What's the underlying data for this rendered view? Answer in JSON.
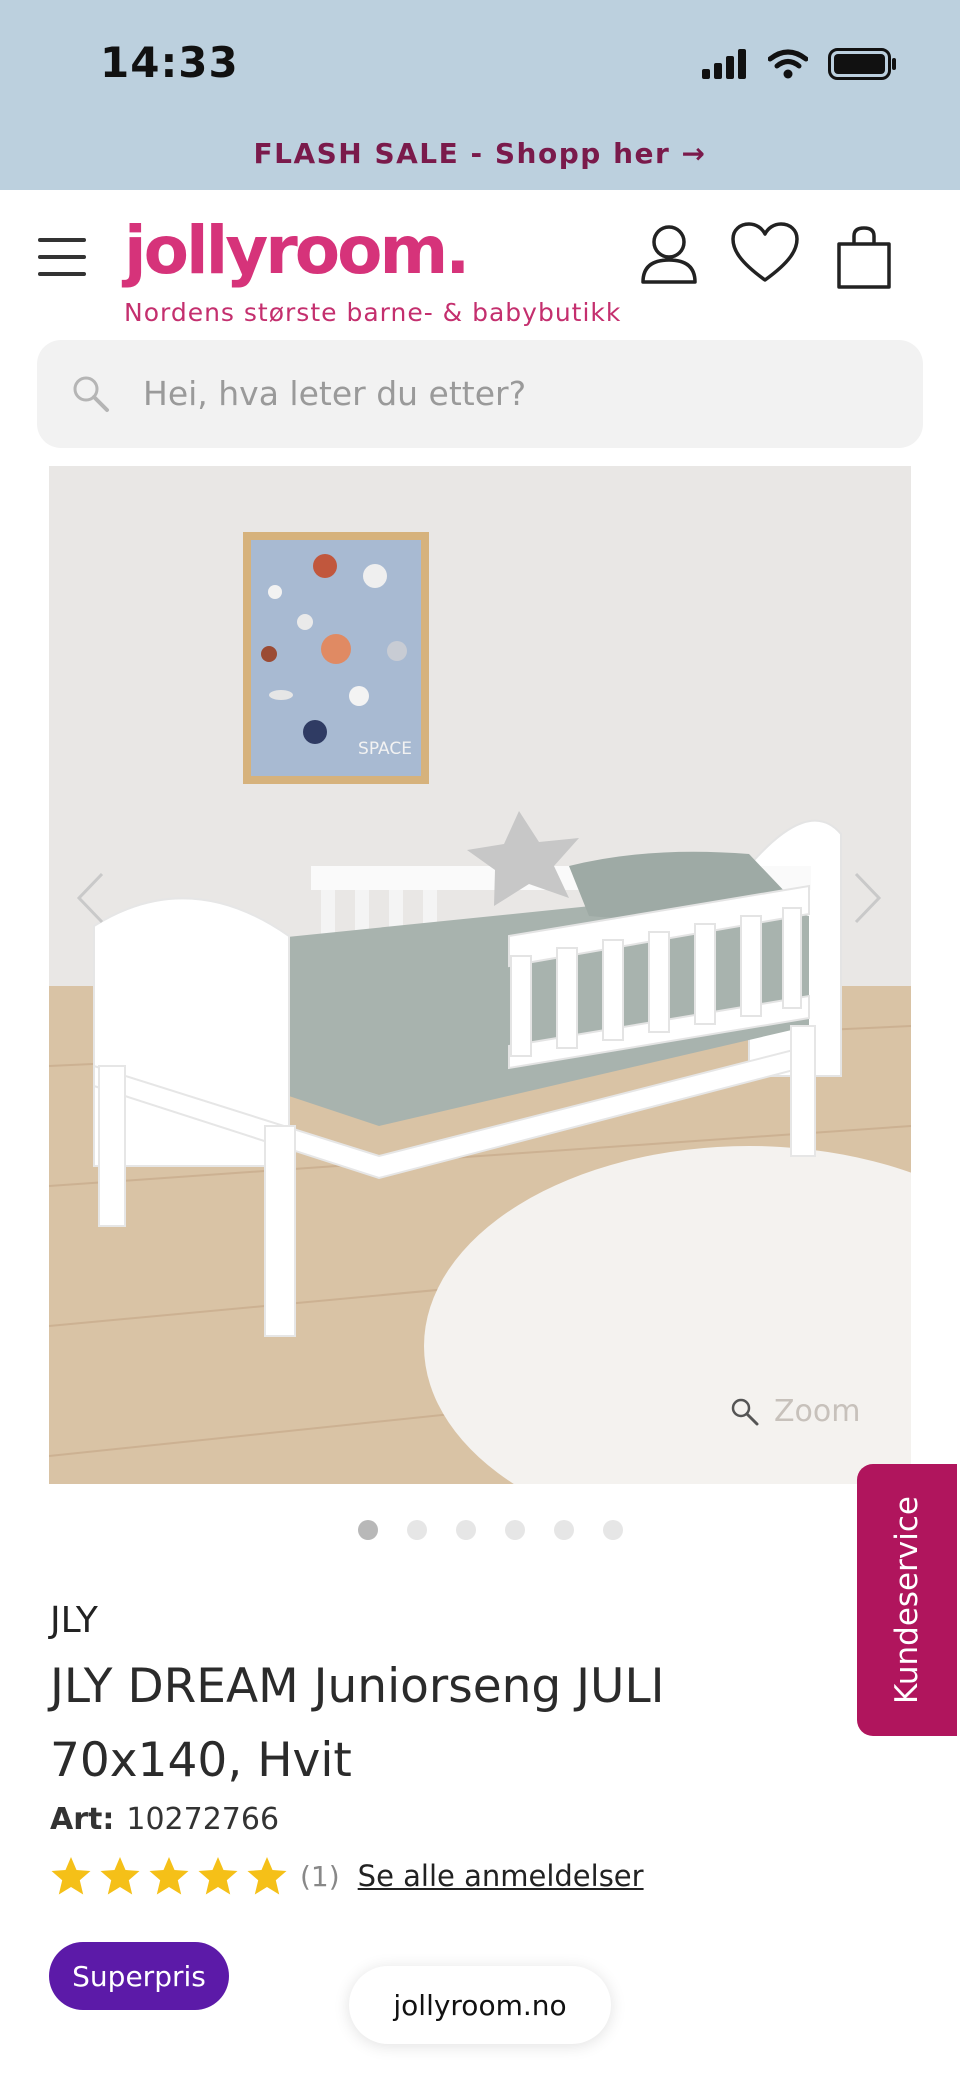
{
  "status_bar": {
    "time": "14:33",
    "icons": [
      "cellular-signal-icon",
      "wifi-icon",
      "battery-icon"
    ]
  },
  "banner": {
    "text": "FLASH SALE - Shopp her →"
  },
  "header": {
    "logo": "jollyroom.",
    "tagline": "Nordens største barne- & babybutikk",
    "icons": [
      "menu-icon",
      "account-icon",
      "heart-icon",
      "shopping-bag-icon"
    ]
  },
  "search": {
    "placeholder": "Hei, hva leter du etter?"
  },
  "gallery": {
    "zoom_label": "Zoom",
    "image_count": 6,
    "active_index": 0,
    "poster_text": "SPACE"
  },
  "side_tab": {
    "label": "Kundeservice"
  },
  "product": {
    "brand": "JLY",
    "title": "JLY DREAM Juniorseng JULI 70x140, Hvit",
    "art_label": "Art:",
    "art_number": "10272766",
    "rating": 5,
    "review_count": "(1)",
    "reviews_link": "Se alle anmeldelser",
    "badge": "Superpris"
  },
  "browser": {
    "url": "jollyroom.no"
  },
  "colors": {
    "brand_pink": "#d6337a",
    "banner_bg": "#bcd0de",
    "side_tab": "#b0155d",
    "badge_purple": "#5c1aa8",
    "star": "#f5c018"
  }
}
